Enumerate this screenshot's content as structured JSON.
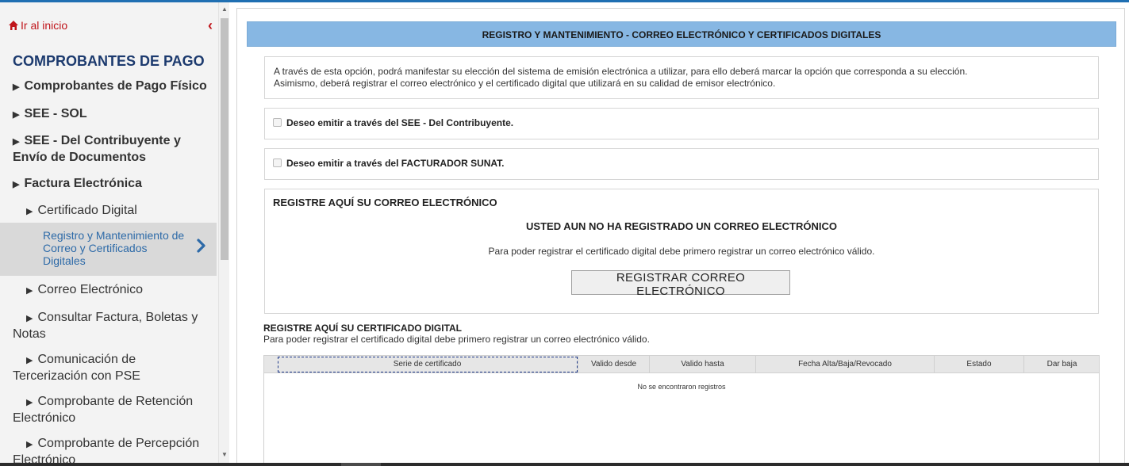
{
  "sidebar": {
    "home_label": "Ir al inicio",
    "section_title": "COMPROBANTES DE PAGO",
    "items": [
      {
        "label": "Comprobantes de Pago Físico"
      },
      {
        "label": "SEE - SOL"
      },
      {
        "label": "SEE - Del Contribuyente y Envío de Documentos"
      },
      {
        "label": "Factura Electrónica"
      }
    ],
    "sub_items": [
      {
        "label": "Certificado Digital"
      },
      {
        "label": "Registro y Mantenimiento de Correo y Certificados Digitales"
      },
      {
        "label": "Correo Electrónico"
      },
      {
        "label": "Consultar Factura, Boletas y Notas"
      },
      {
        "label": "Comunicación de Tercerización con PSE"
      },
      {
        "label": "Comprobante de Retención Electrónico"
      },
      {
        "label": "Comprobante de Percepción Electrónico"
      }
    ],
    "triangle": "▶"
  },
  "main": {
    "header": "REGISTRO Y MANTENIMIENTO - CORREO ELECTRÓNICO Y CERTIFICADOS DIGITALES",
    "intro_line1": "A través de esta opción, podrá manifestar su elección del sistema de emisión electrónica a utilizar, para ello deberá marcar la opción que corresponda a su elección.",
    "intro_line2": "Asimismo, deberá registrar el correo electrónico y el certificado digital que utilizará en su calidad de emisor electrónico.",
    "option_contribuyente": "Deseo emitir a través del SEE - Del Contribuyente.",
    "option_facturador": "Deseo emitir a través del FACTURADOR SUNAT.",
    "email": {
      "title": "REGISTRE AQUÍ SU CORREO ELECTRÓNICO",
      "warning": "USTED AUN NO HA REGISTRADO UN CORREO ELECTRÓNICO",
      "note": "Para poder registrar el certificado digital debe primero registrar un correo electrónico válido.",
      "button": "REGISTRAR CORREO ELECTRÓNICO"
    },
    "certificate": {
      "title": "REGISTRE AQUÍ SU CERTIFICADO DIGITAL",
      "note": "Para poder registrar el certificado digital debe primero registrar un correo electrónico válido.",
      "columns": [
        "Serie de certificado",
        "Valido desde",
        "Valido hasta",
        "Fecha Alta/Baja/Revocado",
        "Estado",
        "Dar baja"
      ],
      "empty": "No se encontraron registros"
    }
  },
  "colors": {
    "accent_red": "#c0151b",
    "title_navy": "#1c3a6e",
    "header_blue": "#87b7e3",
    "active_link": "#2d6aa8"
  }
}
